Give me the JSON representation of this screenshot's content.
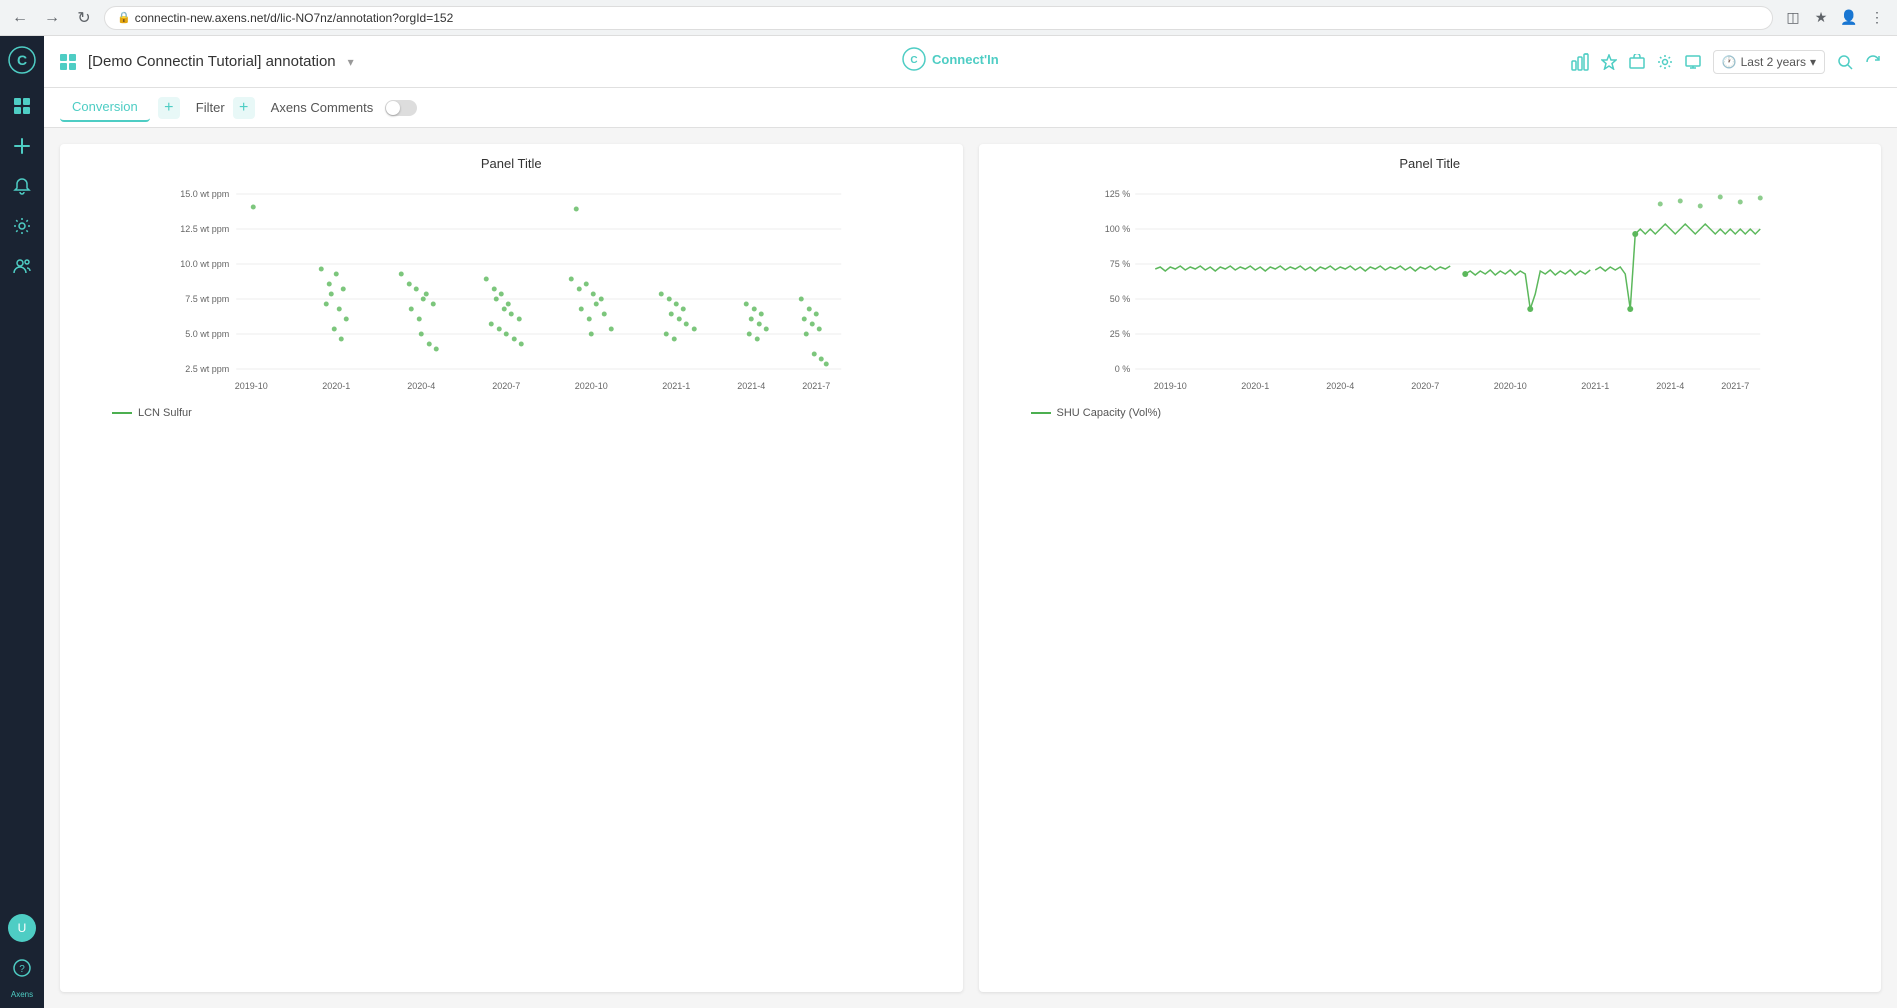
{
  "browser": {
    "url": "connectin-new.axens.net/d/lic-NO7nz/annotation?orgId=152"
  },
  "app": {
    "title": "[Demo Connectin Tutorial] annotation",
    "title_arrow": "▾",
    "logo": "Connect'In"
  },
  "topbar": {
    "time_range_icon": "🕐",
    "time_range_label": "Last 2 years",
    "time_range_arrow": "▾"
  },
  "tabs": {
    "active_tab": "Conversion",
    "add_label": "+",
    "filter_label": "Filter",
    "filter_add": "+",
    "axens_comments_label": "Axens Comments"
  },
  "chart1": {
    "title": "Panel Title",
    "y_axis": [
      "15.0 wt ppm",
      "12.5 wt ppm",
      "10.0 wt ppm",
      "7.5 wt ppm",
      "5.0 wt ppm",
      "2.5 wt ppm"
    ],
    "x_axis": [
      "2019-10",
      "2020-1",
      "2020-4",
      "2020-7",
      "2020-10",
      "2021-1",
      "2021-4",
      "2021-7"
    ],
    "legend": "LCN Sulfur"
  },
  "chart2": {
    "title": "Panel Title",
    "y_axis": [
      "125 %",
      "100 %",
      "75 %",
      "50 %",
      "25 %",
      "0 %"
    ],
    "x_axis": [
      "2019-10",
      "2020-1",
      "2020-4",
      "2020-7",
      "2020-10",
      "2021-1",
      "2021-4",
      "2021-7"
    ],
    "legend": "SHU Capacity (Vol%)"
  },
  "sidebar": {
    "icons": [
      "grid",
      "plus",
      "bell",
      "gear",
      "users"
    ],
    "bottom_icons": [
      "avatar",
      "help"
    ],
    "axens_label": "Axens"
  }
}
